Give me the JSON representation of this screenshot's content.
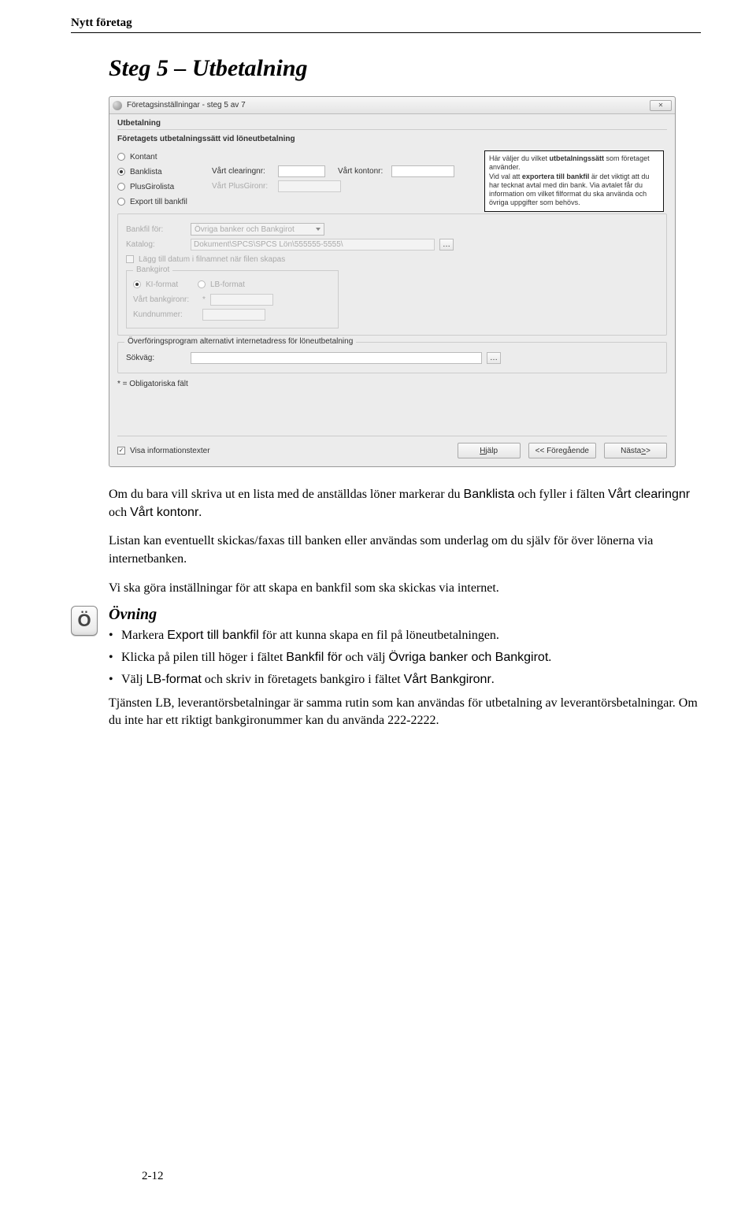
{
  "header": {
    "title": "Nytt företag"
  },
  "section_title": "Steg 5 – Utbetalning",
  "window": {
    "title": "Företagsinställningar - steg 5 av 7",
    "close_label": "✕",
    "panel_title": "Utbetalning",
    "group_caption": "Företagets utbetalningssätt vid löneutbetalning",
    "options": {
      "kontant": "Kontant",
      "banklista": "Banklista",
      "plusgirolista": "PlusGirolista",
      "export_bankfil": "Export till bankfil"
    },
    "fields": {
      "vart_clearingnr": "Vårt clearingnr:",
      "vart_kontonr": "Vårt kontonr:",
      "vart_plusgironr": "Vårt PlusGironr:",
      "bankfil_for": "Bankfil för:",
      "bankfil_for_value": "Övriga banker och Bankgirot",
      "katalog": "Katalog:",
      "katalog_value": "Dokument\\SPCS\\SPCS Lön\\555555-5555\\",
      "lagg_till_datum": "Lägg till datum i filnamnet när filen skapas"
    },
    "bankgirot": {
      "legend": "Bankgirot",
      "ki_format": "KI-format",
      "lb_format": "LB-format",
      "vart_bankgironr": "Vårt bankgironr:",
      "kundnummer": "Kundnummer:"
    },
    "info_box": "Här väljer du vilket utbetalningssätt som företaget använder.\nVid val att exportera till bankfil är det viktigt att du har tecknat avtal med din bank. Via avtalet får du information om vilket filformat du ska använda och övriga uppgifter som behövs.",
    "info_bold1": "utbetalningssätt",
    "info_bold2": "exportera till bankfil",
    "overforing": {
      "legend": "Överföringsprogram alternativt internetadress för löneutbetalning",
      "sokvag": "Sökväg:"
    },
    "footnote": "* = Obligatoriska fält",
    "visa_info": "Visa informationstexter",
    "buttons": {
      "hjalp": "Hjälp",
      "foregaende": "<< Föregående",
      "nasta": "Nästa >>"
    }
  },
  "body": {
    "p1_a": "Om du bara vill skriva ut en lista med de anställdas löner markerar du ",
    "p1_sans1": "Banklista",
    "p1_b": " och fyller i fälten ",
    "p1_sans2": "Vårt clearingnr",
    "p1_c": " och ",
    "p1_sans3": "Vårt kontonr",
    "p1_d": ".",
    "p2": "Listan kan eventuellt skickas/faxas till banken eller användas som underlag om du själv för över lönerna via internetbanken.",
    "p3": "Vi ska göra inställningar för att skapa en bankfil som ska skickas via internet."
  },
  "ovning": {
    "badge": "Ö",
    "heading": "Övning",
    "b1_a": "Markera ",
    "b1_sans": "Export till bankfil",
    "b1_b": " för att kunna skapa en fil på löneutbetalningen.",
    "b2_a": "Klicka på pilen till höger i fältet ",
    "b2_sans1": "Bankfil för",
    "b2_b": " och välj ",
    "b2_sans2": "Övriga banker och Bankgirot",
    "b2_c": ".",
    "b3_a": "Välj ",
    "b3_sans1": "LB-format",
    "b3_b": " och skriv in företagets bankgiro i fältet ",
    "b3_sans2": "Vårt Bankgironr",
    "b3_c": ".",
    "p_after": "Tjänsten LB, leverantörsbetalningar är samma rutin som kan användas för utbetalning av leverantörsbetalningar. Om du inte har ett riktigt bankgironummer kan du använda 222-2222."
  },
  "page_number": "2-12"
}
